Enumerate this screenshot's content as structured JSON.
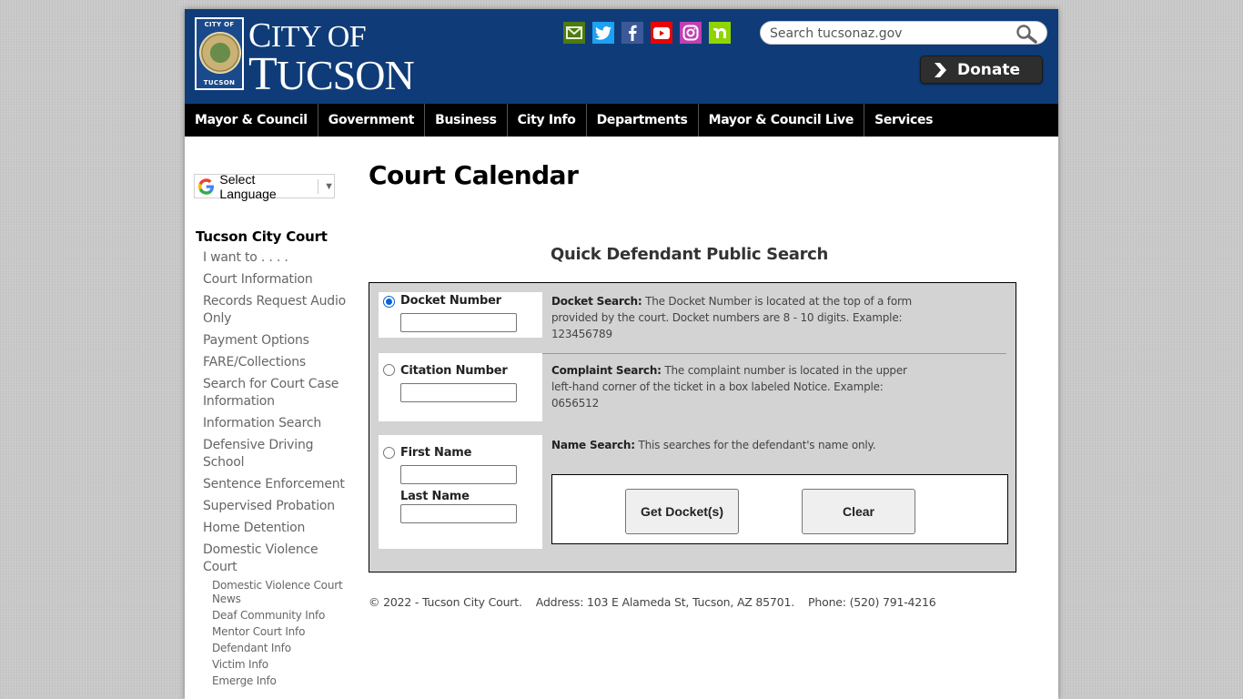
{
  "header": {
    "logo": {
      "seal_top": "CITY OF",
      "seal_bottom": "TUCSON",
      "line1_initial": "C",
      "line1_rest": "ITY OF",
      "line2_initial": "T",
      "line2_rest": "UCSON"
    },
    "social": [
      {
        "name": "email-icon",
        "glyph": "✉"
      },
      {
        "name": "twitter-icon",
        "glyph": "t"
      },
      {
        "name": "facebook-icon",
        "glyph": "f"
      },
      {
        "name": "youtube-icon",
        "glyph": "▶"
      },
      {
        "name": "instagram-icon",
        "glyph": "◎"
      },
      {
        "name": "nextdoor-icon",
        "glyph": "n"
      }
    ],
    "search": {
      "placeholder": "Search tucsonaz.gov",
      "value": ""
    },
    "donate_label": "Donate"
  },
  "nav": {
    "items": [
      "Mayor & Council",
      "Government",
      "Business",
      "City Info",
      "Departments",
      "Mayor & Council Live",
      "Services"
    ]
  },
  "language": {
    "label": "Select Language",
    "arrow": "▼"
  },
  "sidebar": {
    "title": "Tucson City Court",
    "items": [
      "I want to . . . .",
      "Court Information",
      "Records Request Audio Only",
      "Payment Options",
      "FARE/Collections",
      "Search for Court Case Information",
      "Information Search",
      "Defensive Driving School",
      "Sentence Enforcement",
      "Supervised Probation",
      "Home Detention",
      "Domestic Violence Court"
    ],
    "sub_items": [
      "Domestic Violence Court News",
      "Deaf Community Info",
      "Mentor Court Info",
      "Defendant Info",
      "Victim Info",
      "Emerge Info"
    ]
  },
  "main": {
    "title": "Court Calendar",
    "subtitle": "Quick Defendant Public Search",
    "form": {
      "docket": {
        "label": "Docket Number",
        "selected": true,
        "value": "",
        "desc_title": "Docket Search:",
        "desc_text": " The Docket Number is located at the top of a form provided by the court. Docket numbers are 8 - 10 digits. Example: 123456789"
      },
      "citation": {
        "label": "Citation Number",
        "selected": false,
        "value": "",
        "desc_title": "Complaint Search:",
        "desc_text": " The complaint number is located in the upper left-hand corner of the ticket in a box labeled Notice. Example: 0656512"
      },
      "name": {
        "selected": false,
        "first_label": "First Name",
        "first_value": "",
        "last_label": "Last Name",
        "last_value": "",
        "desc_title": "Name Search:",
        "desc_text": " This searches for the defendant's name only."
      },
      "get_button": "Get Docket(s)",
      "clear_button": "Clear"
    }
  },
  "footer": {
    "text": "© 2022 - Tucson City Court.    Address: 103 E Alameda St, Tucson, AZ 85701.    Phone: (520) 791-4216"
  }
}
